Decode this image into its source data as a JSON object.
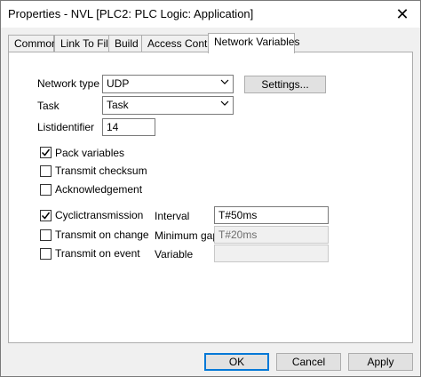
{
  "window": {
    "title": "Properties - NVL [PLC2: PLC Logic: Application]",
    "close_glyph": "✕"
  },
  "tabs": [
    {
      "label": "Common",
      "active": false
    },
    {
      "label": "Link To File",
      "active": false
    },
    {
      "label": "Build",
      "active": false
    },
    {
      "label": "Access Control",
      "active": false
    },
    {
      "label": "Network Variables",
      "active": true
    }
  ],
  "form": {
    "network_type_label": "Network type",
    "network_type_value": "UDP",
    "settings_button": "Settings...",
    "task_label": "Task",
    "task_value": "Task",
    "listidentifier_label": "Listidentifier",
    "listidentifier_value": "14",
    "pack_variables": {
      "label": "Pack variables",
      "checked": true
    },
    "transmit_checksum": {
      "label": "Transmit checksum",
      "checked": false
    },
    "acknowledgement": {
      "label": "Acknowledgement",
      "checked": false
    },
    "cyclic_transmission": {
      "label": "Cyclictransmission",
      "checked": true
    },
    "transmit_on_change": {
      "label": "Transmit on change",
      "checked": false
    },
    "transmit_on_event": {
      "label": "Transmit on event",
      "checked": false
    },
    "interval_label": "Interval",
    "interval_value": "T#50ms",
    "minimum_gap_label": "Minimum gap",
    "minimum_gap_value": "T#20ms",
    "variable_label": "Variable",
    "variable_value": ""
  },
  "footer": {
    "ok": "OK",
    "cancel": "Cancel",
    "apply": "Apply"
  },
  "icons": {
    "dropdown": "chevron-down-icon",
    "check": "✓"
  }
}
